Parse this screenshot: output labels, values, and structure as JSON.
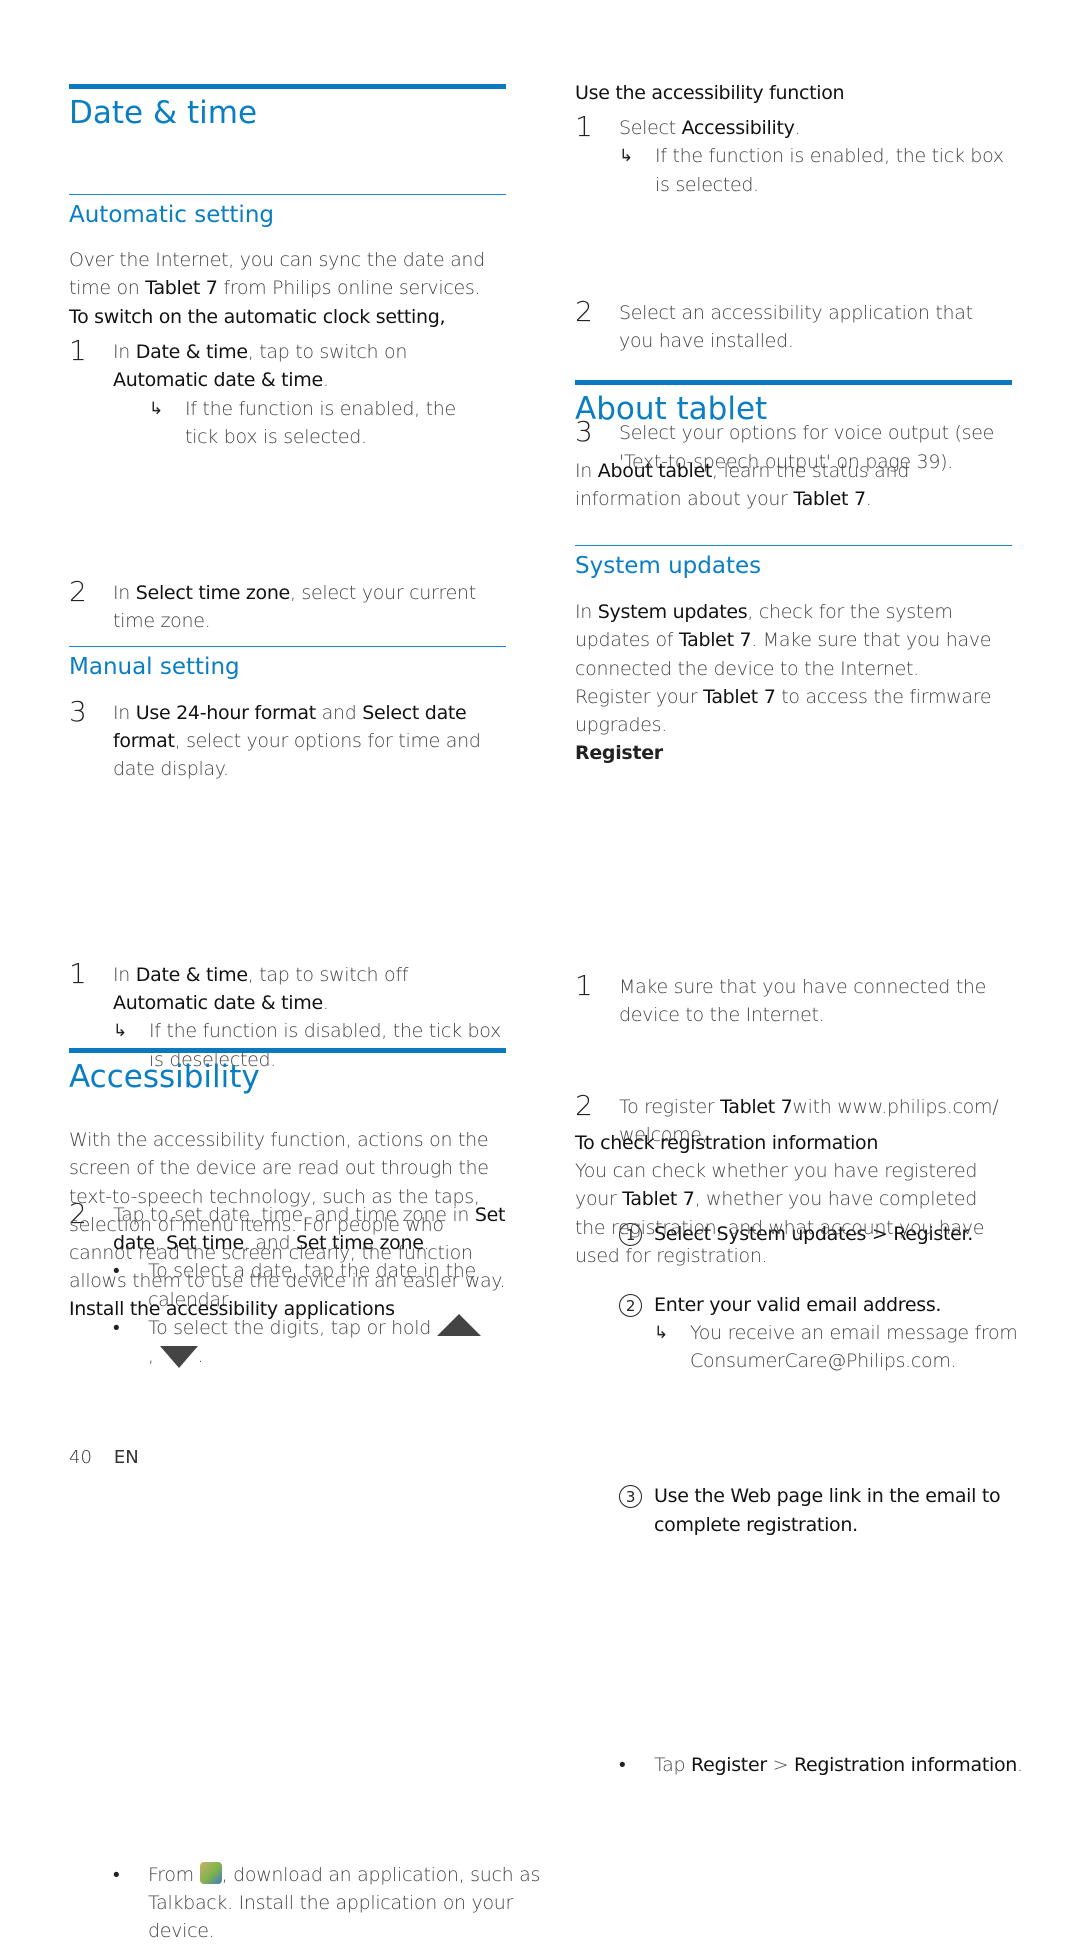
{
  "colors": {
    "heading": "#0a7ec2",
    "rule": "#0a79bf",
    "text": "#444444"
  },
  "left": {
    "date_time": {
      "title": "Date & time",
      "automatic": {
        "title": "Automatic setting",
        "intro_1": "Over the Internet, you can sync the date and",
        "intro_2a": "time on ",
        "intro_2b": "Tablet 7",
        "intro_2c": " from Philips online services.",
        "lead": "To switch on the automatic clock setting,",
        "steps": [
          {
            "num": "1",
            "a": "In ",
            "b": "Date & time",
            "c": ", tap to switch on ",
            "d": "Automatic date & time",
            "e": ".",
            "result": "If the function is enabled, the tick box is selected."
          },
          {
            "num": "2",
            "a": "In ",
            "b": "Select time zone",
            "c": ", select your current time zone."
          },
          {
            "num": "3",
            "a": "In ",
            "b": "Use 24-hour format",
            "c": " and ",
            "d": "Select date format",
            "e": ", select your options for time and date display."
          }
        ]
      },
      "manual": {
        "title": "Manual setting",
        "steps": [
          {
            "num": "1",
            "a": "In ",
            "b": "Date & time",
            "c": ", tap to switch off ",
            "d": "Automatic date & time",
            "e": ".",
            "result": "If the function is disabled, the tick box is deselected."
          },
          {
            "num": "2",
            "a": "Tap to set date, time, and time zone in ",
            "b": "Set date",
            "c": ", ",
            "d": "Set time",
            "e": ", and ",
            "f": "Set time zone",
            "g": "."
          }
        ],
        "bullets": [
          {
            "text": "To select a date, tap the date in the calendar."
          },
          {
            "text": "To select the digits, tap or hold",
            "icon_up": "arrow-up-icon",
            "sep": ",",
            "icon_down": "arrow-down-icon",
            "end": "."
          }
        ]
      }
    },
    "accessibility": {
      "title": "Accessibility",
      "body": "With the accessibility function, actions on the screen of the device are read out through the text-to-speech technology, such as the taps, selection of menu items. For people who cannot read the screen clearly, the function allows them to use the device in an easier way.",
      "install_lead": "Install the accessibility applications",
      "bullet_a": "From ",
      "bullet_icon": "market-icon",
      "bullet_b": ", download an application, such as Talkback. Install the application on your device."
    }
  },
  "right": {
    "use_accessibility": {
      "lead": "Use the accessibility function",
      "steps": [
        {
          "num": "1",
          "a": "Select ",
          "b": "Accessibility",
          "c": ".",
          "result": "If the function is enabled, the tick box is selected."
        },
        {
          "num": "2",
          "a": "Select an accessibility application that you have installed."
        },
        {
          "num": "3",
          "a": "Select your options for voice output (see 'Text-to-speech output' on page 39)."
        }
      ]
    },
    "about": {
      "title": "About tablet",
      "a": "In ",
      "b": "About tablet",
      "c": ", learn the status and information about your ",
      "d": "Tablet 7",
      "e": "."
    },
    "system_updates": {
      "title": "System updates",
      "p1a": "In ",
      "p1b": "System updates",
      "p1c": ", check for the system updates of ",
      "p1d": "Tablet 7",
      "p1e": ". Make sure that you have connected the device to the Internet.",
      "p2a": "Register your ",
      "p2b": "Tablet 7",
      "p2c": " to access the firmware upgrades.",
      "register_title": "Register",
      "steps": [
        {
          "num": "1",
          "a": "Make sure that you have connected the device to the Internet."
        },
        {
          "num": "2",
          "a": "To register ",
          "b": "Tablet 7",
          "c": "with www.philips.com/ welcome,"
        }
      ],
      "substeps": [
        {
          "num": "1",
          "text": "Select System updates > Register."
        },
        {
          "num": "2",
          "text": "Enter your valid email address.",
          "result": "You receive an email message from ConsumerCare@Philips.com."
        },
        {
          "num": "3",
          "text": "Use the Web page link in the email to complete registration."
        }
      ],
      "check_title": "To check registration information",
      "check_body_a": "You can check whether you have registered your ",
      "check_body_b": "Tablet 7",
      "check_body_c": ", whether you have completed the registration, and what account you have used for registration.",
      "check_bullet_a": "Tap ",
      "check_bullet_b": "Register",
      "check_bullet_c": " > ",
      "check_bullet_d": "Registration information",
      "check_bullet_e": "."
    }
  },
  "footer": {
    "page_number": "40",
    "language": "EN"
  }
}
